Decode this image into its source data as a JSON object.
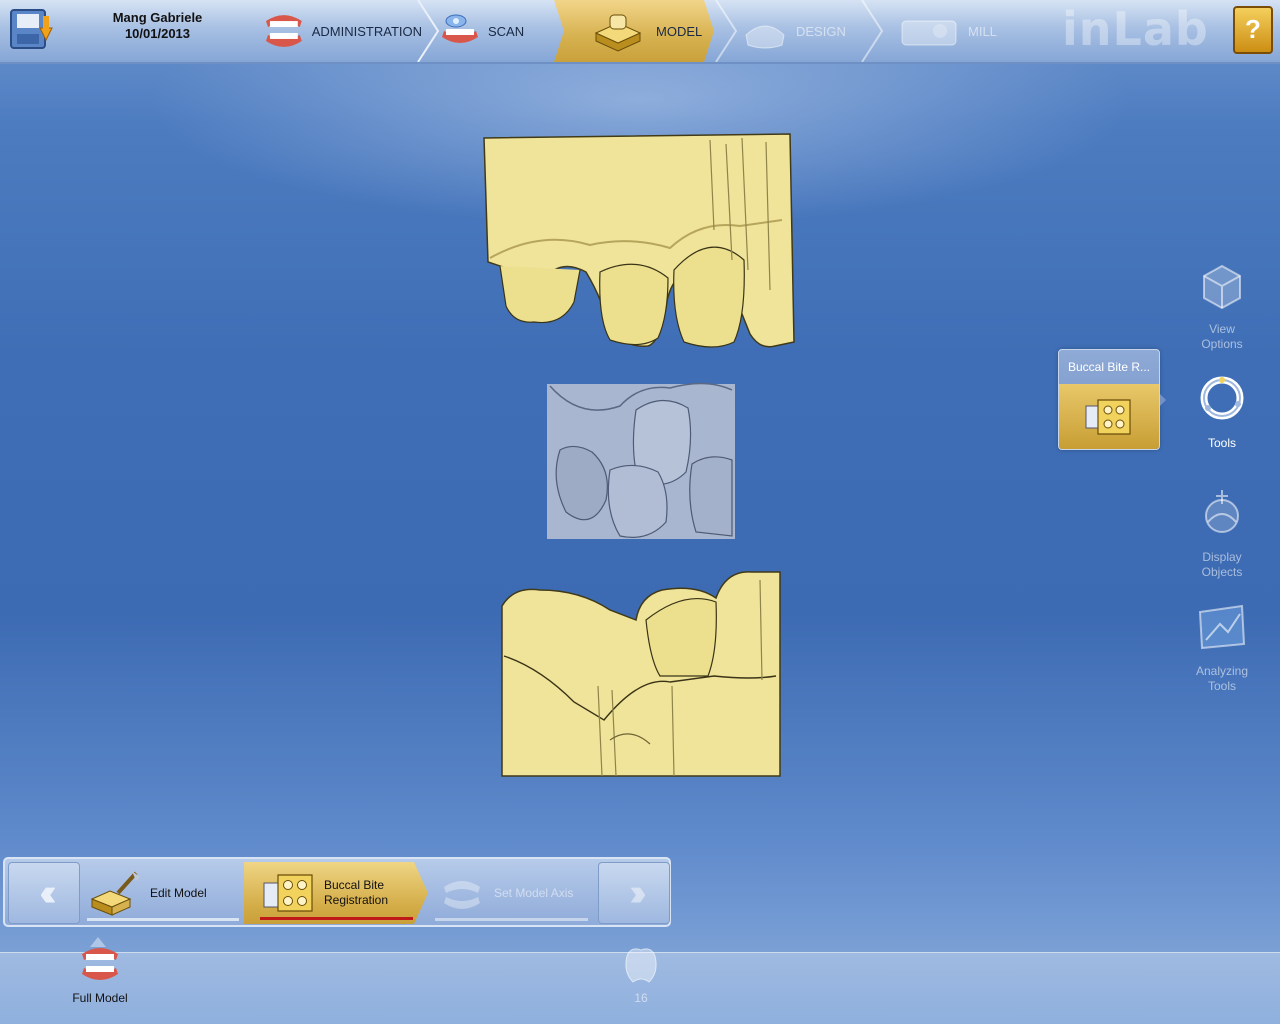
{
  "header": {
    "patient_name": "Mang Gabriele",
    "date": "10/01/2013",
    "logo": "inLab",
    "steps": [
      {
        "label": "ADMINISTRATION",
        "icon": "jaw-model-icon",
        "state": "done"
      },
      {
        "label": "SCAN",
        "icon": "scanner-icon",
        "state": "done"
      },
      {
        "label": "MODEL",
        "icon": "model-base-icon",
        "state": "active"
      },
      {
        "label": "DESIGN",
        "icon": "design-icon",
        "state": "disabled"
      },
      {
        "label": "MILL",
        "icon": "mill-icon",
        "state": "disabled"
      }
    ],
    "help_icon": "help-book-icon"
  },
  "side_tools": [
    {
      "label": "View\nOptions",
      "icon": "view-options-cube-icon",
      "enabled": false
    },
    {
      "label": "Tools",
      "icon": "tools-ring-icon",
      "enabled": true
    },
    {
      "label": "Display\nObjects",
      "icon": "display-objects-icon",
      "enabled": false
    },
    {
      "label": "Analyzing\nTools",
      "icon": "analyzing-tools-icon",
      "enabled": false
    }
  ],
  "tool_popup": {
    "title": "Buccal Bite R...",
    "icon": "buccal-bite-icon"
  },
  "workflow": {
    "steps": [
      {
        "label": "Edit Model",
        "icon": "edit-model-icon",
        "state": "done"
      },
      {
        "label": "Buccal Bite\nRegistration",
        "icon": "buccal-bite-icon",
        "state": "active"
      },
      {
        "label": "Set Model Axis",
        "icon": "set-model-axis-icon",
        "state": "disabled"
      }
    ],
    "prev_icon": "double-chevron-left-icon",
    "next_icon": "double-chevron-right-icon"
  },
  "objects": [
    {
      "label": "Full Model",
      "icon": "full-model-jaw-icon",
      "enabled": true
    },
    {
      "label": "16",
      "icon": "tooth-icon",
      "enabled": false
    }
  ],
  "colors": {
    "model_yellow": "#f0e39a",
    "bite_scan_gray": "#a9b6cf",
    "active_gold": "#d6b14f",
    "progress_red": "#c01818"
  }
}
